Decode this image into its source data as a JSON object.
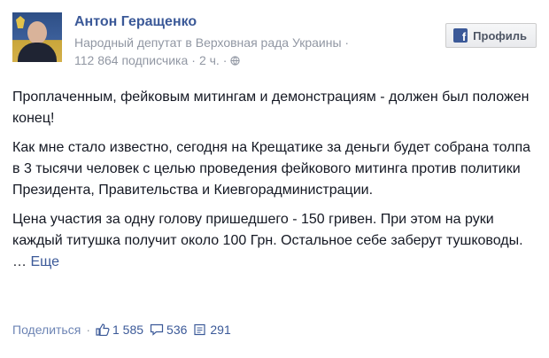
{
  "author": {
    "name": "Антон Геращенко",
    "subtitle": "Народный депутат в Верховная рада Украины · ",
    "subscribers": "112 864 подписчика",
    "separator": "·",
    "time": "2 ч.",
    "audience_icon": "globe-icon"
  },
  "profile_button": {
    "label": "Профиль",
    "icon": "facebook-icon"
  },
  "post": {
    "paragraphs": [
      "Проплаченным, фейковым митингам и демонстрациям - должен был положен конец!",
      "Как мне стало известно, сегодня на Крещатике за деньги будет собрана толпа в 3 тысячи человек с целью проведения фейкового митинга против политики Президента, Правительства и Киевгорадминистрации.",
      "Цена участия за одну голову пришедшего - 150 гривен. При этом на руки каждый титушка получит около 100 Грн. Остальное себе заберут тушководы. …"
    ],
    "more_label": "Еще"
  },
  "actions": {
    "share_label": "Поделиться",
    "likes": "1 585",
    "comments": "536",
    "shares": "291"
  },
  "colors": {
    "link": "#3b5998",
    "meta": "#9197a3",
    "text": "#141823"
  }
}
